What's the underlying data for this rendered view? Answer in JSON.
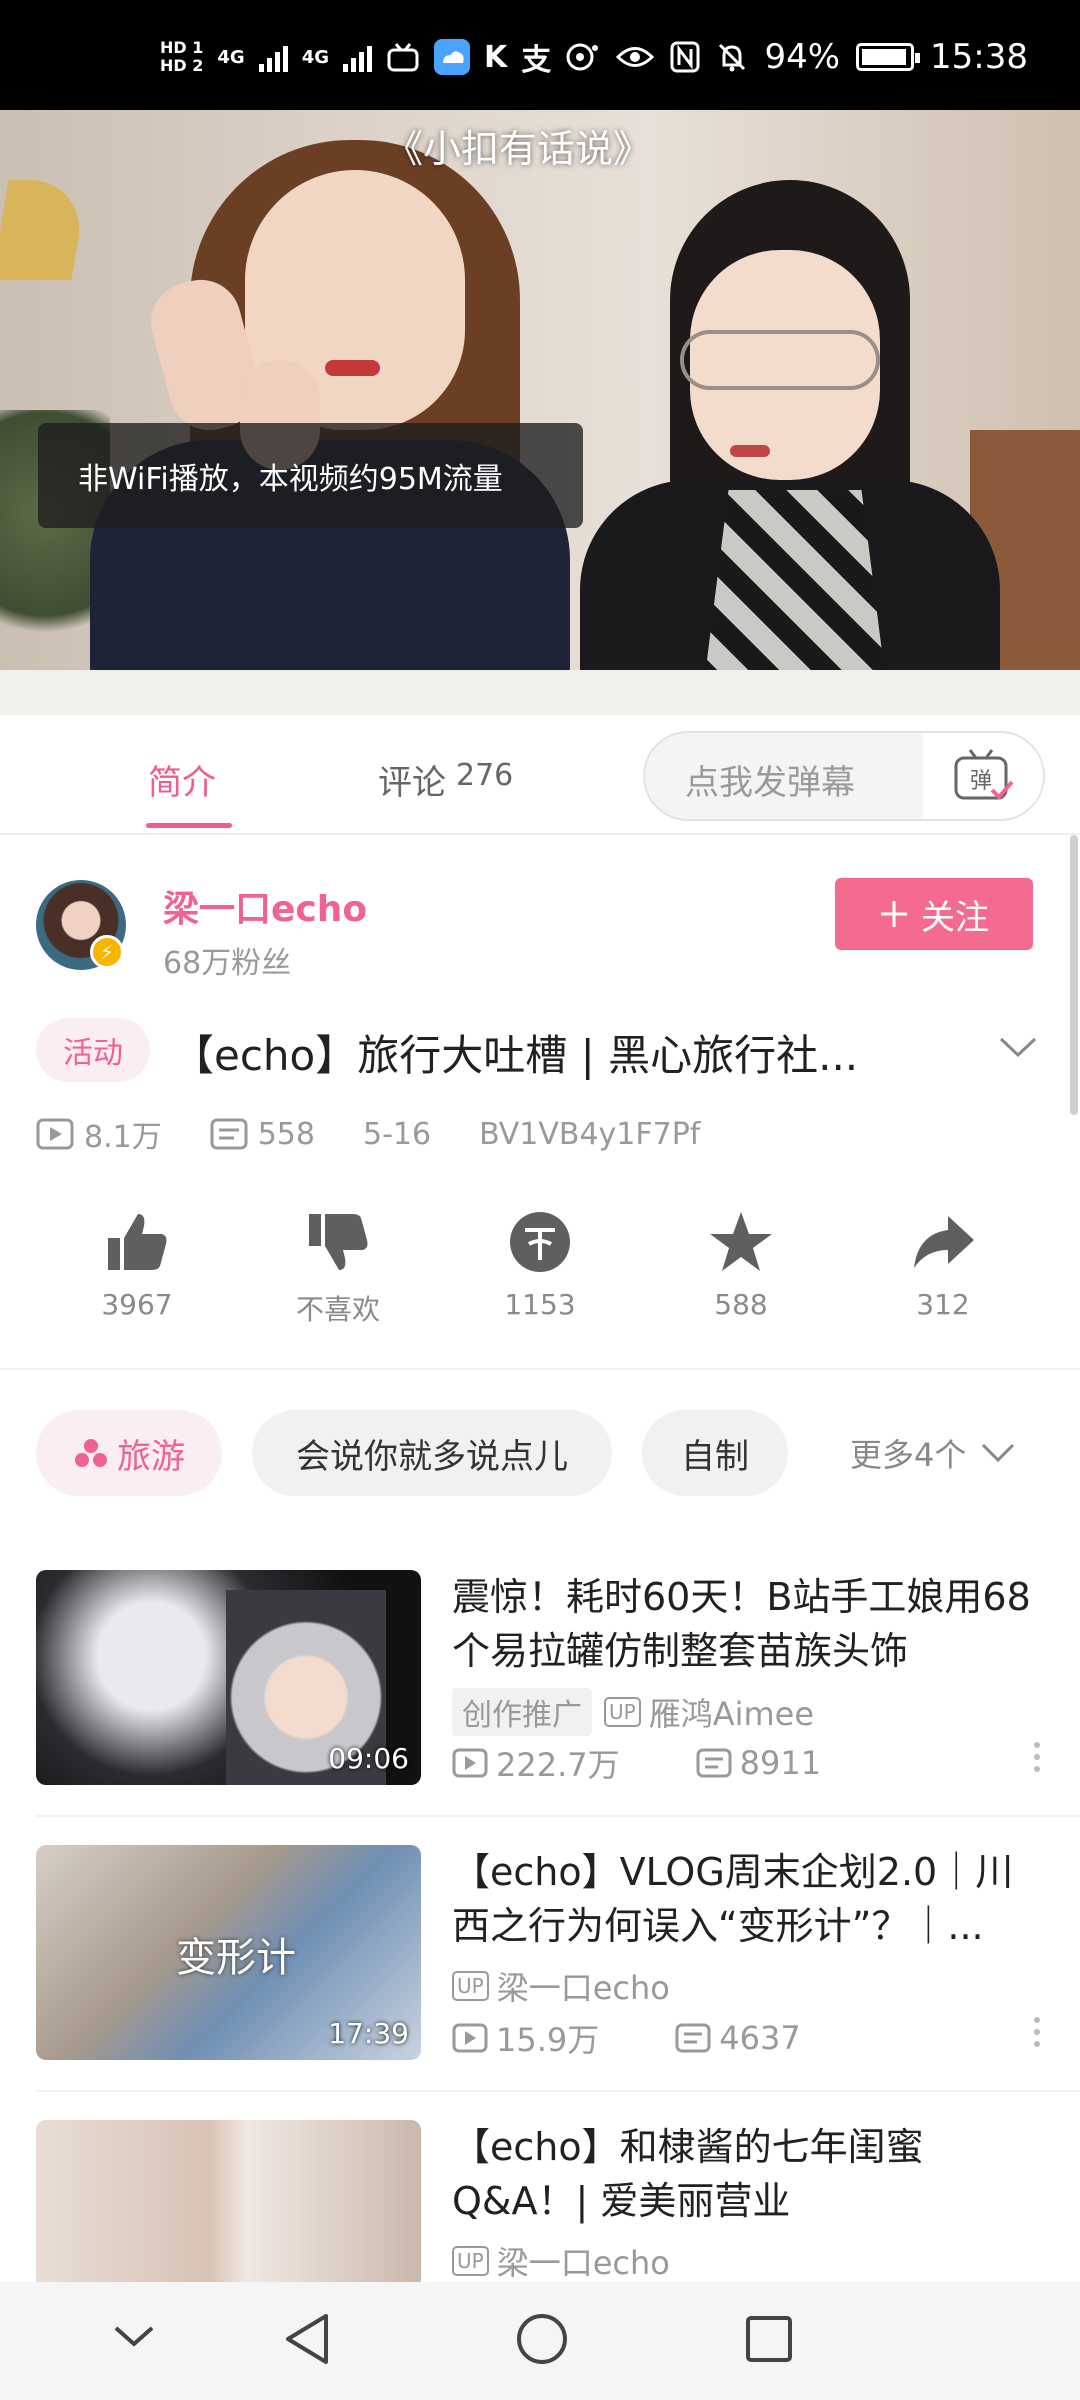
{
  "status_bar": {
    "hd1": "HD 1",
    "hd2": "HD 2",
    "net1": "4G",
    "net2": "4G",
    "k_icon_text": "K",
    "pay_icon_text": "支",
    "battery": "94%",
    "time": "15:38"
  },
  "video": {
    "caption": "《小扣有话说》",
    "toast": "非WiFi播放，本视频约95M流量"
  },
  "tabs": {
    "intro": "简介",
    "comments": "评论",
    "comments_count": "276",
    "danmu_placeholder": "点我发弹幕",
    "danmu_icon_text": "弹"
  },
  "uploader": {
    "name": "梁一口echo",
    "fans": "68万粉丝",
    "follow_label": "关注"
  },
  "video_info": {
    "tag": "活动",
    "title": "【echo】旅行大吐槽 | 黑心旅行社...",
    "views": "8.1万",
    "danmaku": "558",
    "date": "5-16",
    "bvid": "BV1VB4y1F7Pf"
  },
  "actions": [
    {
      "icon": "thumb-up-icon",
      "label": "3967"
    },
    {
      "icon": "thumb-down-icon",
      "label": "不喜欢"
    },
    {
      "icon": "coin-icon",
      "label": "1153"
    },
    {
      "icon": "star-icon",
      "label": "588"
    },
    {
      "icon": "share-icon",
      "label": "312"
    }
  ],
  "tags": {
    "items": [
      "旅游",
      "会说你就多说点儿",
      "自制"
    ],
    "more": "更多4个"
  },
  "recommendations": [
    {
      "title": "震惊！耗时60天！B站手工娘用68个易拉罐仿制整套苗族头饰",
      "duration": "09:06",
      "promo": "创作推广",
      "up_label": "UP",
      "uploader": "雁鸿Aimee",
      "views": "222.7万",
      "danmaku": "8911"
    },
    {
      "title": "【echo】VLOG周末企划2.0｜川西之行为何误入“变形计”？｜...",
      "duration": "17:39",
      "thumb_text": "变形计",
      "up_label": "UP",
      "uploader": "梁一口echo",
      "views": "15.9万",
      "danmaku": "4637"
    },
    {
      "title": "【echo】和棣酱的七年闺蜜Q&A！| 爱美丽营业",
      "up_label": "UP",
      "uploader": "梁一口echo"
    }
  ],
  "colors": {
    "accent": "#f06292",
    "follow_bg": "#f46b8f",
    "status_bar": "#000000"
  }
}
